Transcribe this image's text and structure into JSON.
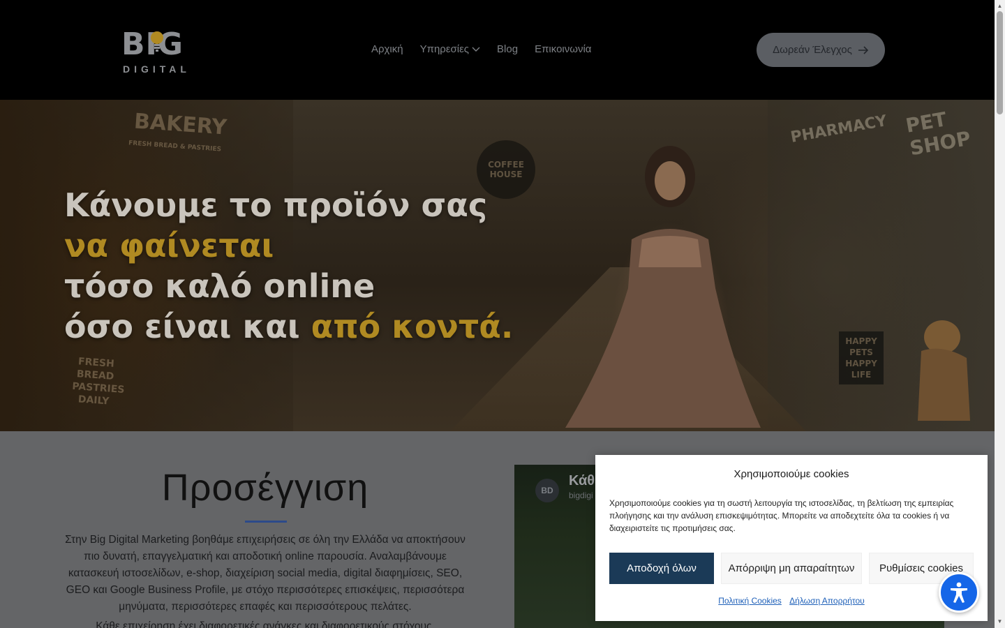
{
  "brand": {
    "logo_top": "BIG",
    "logo_bottom": "DIGITAL"
  },
  "nav": {
    "items": [
      {
        "label": "Αρχική"
      },
      {
        "label": "Υπηρεσίες"
      },
      {
        "label": "Blog"
      },
      {
        "label": "Επικοινωνία"
      }
    ],
    "cta_label": "Δωρεάν Έλεγχος"
  },
  "hero": {
    "line1": "Κάνουμε το προϊόν σας",
    "line2": "να φαίνεται",
    "line3": "τόσο καλό online",
    "line4_a": "όσο είναι και ",
    "line4_b": "από κοντά.",
    "signs": {
      "bakery": "BAKERY",
      "bakery_sub": "FRESH BREAD & PASTRIES",
      "coffee": "COFFEE HOUSE",
      "pharmacy": "PHARMACY",
      "petshop": "PET SHOP",
      "board": "HAPPY PETS HAPPY LIFE",
      "bread": "FRESH BREAD PASTRIES DAILY"
    }
  },
  "approach": {
    "title": "Προσέγγιση",
    "paragraph": "Στην Big Digital Marketing βοηθάμε επιχειρήσεις σε όλη την Ελλάδα να αποκτήσουν πιο δυνατή, επαγγελματική και αποδοτική online παρουσία. Αναλαμβάνουμε κατασκευή ιστοσελίδων, e-shop, διαχείριση social media, digital διαφημίσεις, SEO, GEO και Google Business Profile, με στόχο περισσότερες επισκέψεις, περισσότερα μηνύματα, περισσότερες επαφές και περισσότερους πελάτες.",
    "paragraph2": "Κάθε επιχείρηση έχει διαφορετικές ανάγκες και διαφορετικούς στόχους."
  },
  "video": {
    "badge": "BD",
    "title": "Κάθε",
    "subtitle": "bigdigi"
  },
  "cookie": {
    "title": "Χρησιμοποιούμε cookies",
    "text": "Χρησιμοποιούμε cookies για τη σωστή λειτουργία της ιστοσελίδας, τη βελτίωση της εμπειρίας πλοήγησης και την ανάλυση επισκεψιμότητας. Μπορείτε να αποδεχτείτε όλα τα cookies ή να διαχειριστείτε τις προτιμήσεις σας.",
    "accept": "Αποδοχή όλων",
    "deny": "Απόρριψη μη απαραίτητων",
    "settings": "Ρυθμίσεις cookies",
    "link_policy": "Πολιτική Cookies",
    "link_privacy": "Δήλωση Απορρήτου"
  },
  "colors": {
    "accent_gold": "#b08a22",
    "accept_bg": "#1b3a57",
    "accessibility_bg": "#1566e8",
    "link": "#1d5fb8"
  }
}
